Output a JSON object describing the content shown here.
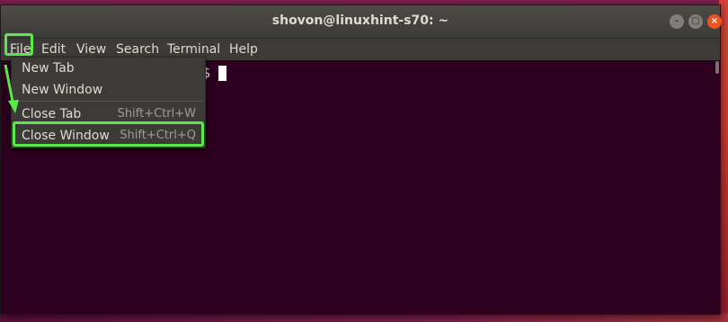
{
  "window": {
    "title": "shovon@linuxhint-s70: ~",
    "controls": [
      {
        "name": "minimize",
        "glyph": "–"
      },
      {
        "name": "maximize",
        "glyph": "□"
      },
      {
        "name": "close",
        "glyph": "×"
      }
    ]
  },
  "menubar": {
    "items": [
      "File",
      "Edit",
      "View",
      "Search",
      "Terminal",
      "Help"
    ]
  },
  "file_menu": {
    "items": [
      {
        "label": "New Tab",
        "accel": ""
      },
      {
        "label": "New Window",
        "accel": ""
      },
      {
        "label": "Close Tab",
        "accel": "Shift+Ctrl+W"
      },
      {
        "label": "Close Window",
        "accel": "Shift+Ctrl+Q"
      }
    ]
  },
  "terminal": {
    "prompt_tail": "$"
  },
  "colors": {
    "accent_highlight": "#5ae84a",
    "terminal_bg": "#2c001e",
    "close_button": "#e95420"
  }
}
